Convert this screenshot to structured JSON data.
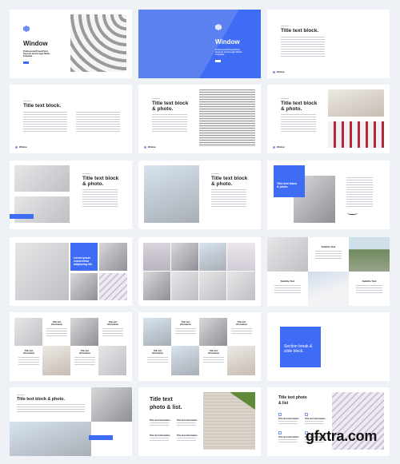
{
  "accent_color": "#3e6cf4",
  "slides": {
    "cover_light": {
      "title": "Window",
      "subtitle": "Professional PowerPoint, Keynote and Google Slides Template",
      "logo_icon": "cube-logo-icon"
    },
    "cover_blue": {
      "title": "Window",
      "subtitle": "Professional PowerPoint, Keynote and Google Slides Template"
    },
    "title_block_1": {
      "title": "Title text block.",
      "footer": "Window"
    },
    "title_block_2": {
      "title": "Title text block.",
      "footer": "Window"
    },
    "title_photo_1": {
      "title": "Title text block & photo.",
      "footer": "Window"
    },
    "title_photo_2": {
      "title": "Title text block & photo.",
      "footer": "Window"
    },
    "title_photo_3": {
      "title": "Title text block & photo."
    },
    "title_photo_4": {
      "title": "Title text block & photo."
    },
    "title_photo_5": {
      "title": "Title text block & photo."
    },
    "lorem_grid": {
      "text": "Lorem ipsum consectetur adipiscing elit."
    },
    "subtitle_grid": {
      "items": [
        "Subtitle Text",
        "Subtitle Text",
        "Subtitle Text"
      ]
    },
    "info_grid_1": {
      "items": [
        "Title text information",
        "Title text information",
        "Title text information",
        "Title text information"
      ]
    },
    "info_grid_2": {
      "items": [
        "Title text information",
        "Title text information",
        "Title text information",
        "Title text information"
      ]
    },
    "section_break": {
      "title": "Section break & slide block."
    },
    "wide_title": {
      "title": "Title text block & photo."
    },
    "photo_list_1": {
      "title": "Title text photo & list.",
      "items": [
        "Title text information",
        "Title text information",
        "Title text information",
        "Title text information"
      ]
    },
    "photo_list_2": {
      "title": "Title text photo & list",
      "items": [
        "Title text information",
        "Title text information",
        "Title text information",
        "Title text information"
      ]
    }
  },
  "watermark": "gfxtra.com"
}
